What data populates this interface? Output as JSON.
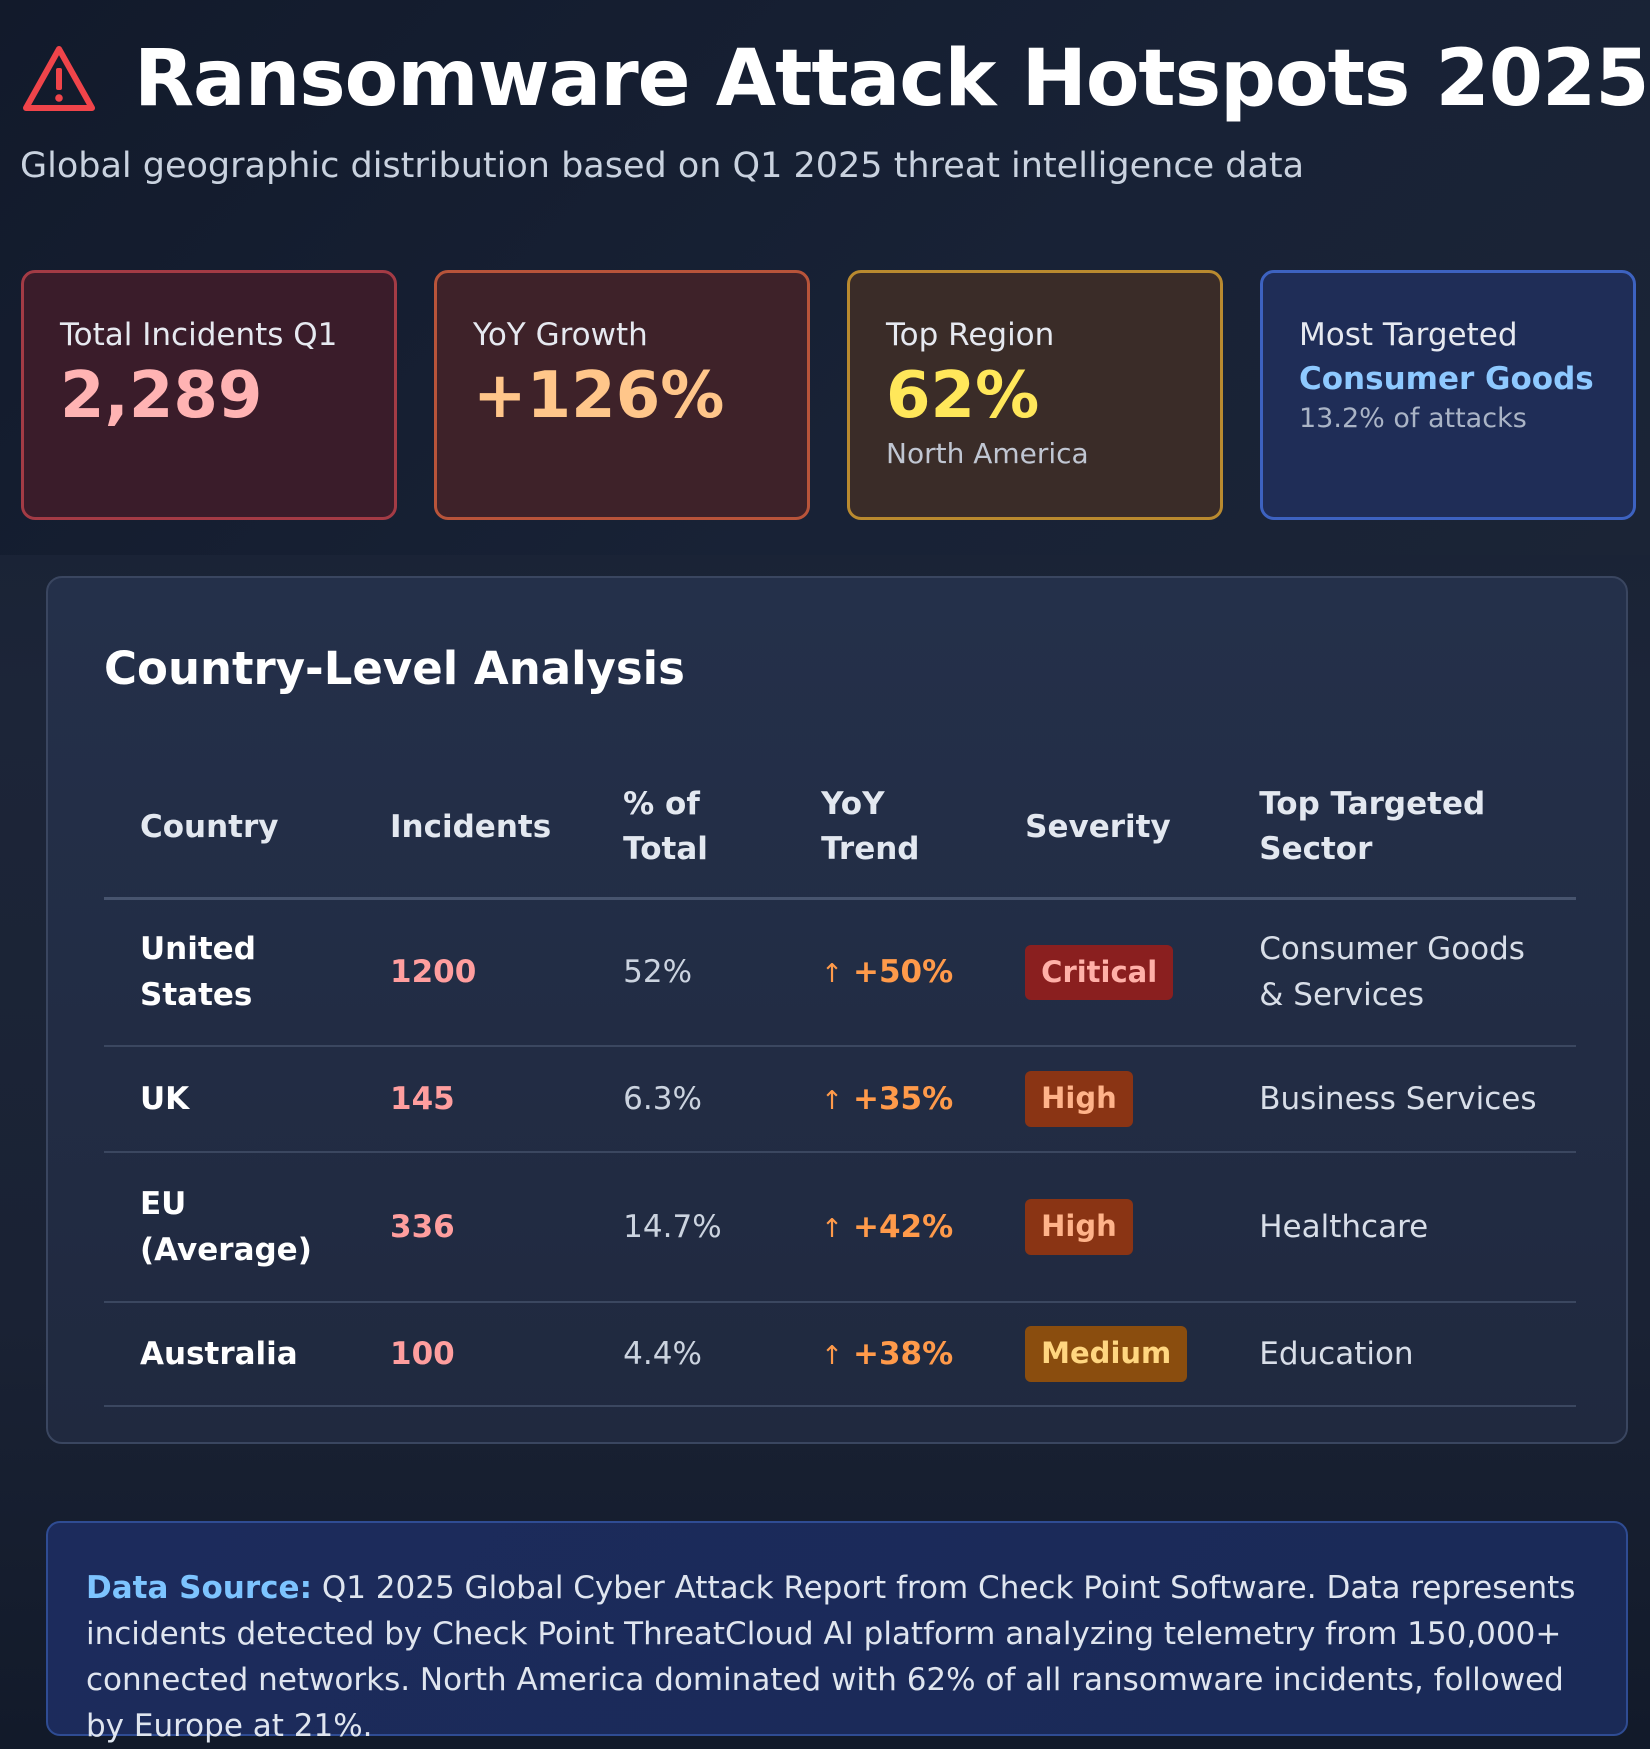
{
  "header": {
    "icon": "warning-triangle-icon",
    "title": "Ransomware Attack Hotspots 2025",
    "subtitle": "Global geographic distribution based on Q1 2025 threat intelligence data"
  },
  "cards": [
    {
      "label": "Total Incidents Q1",
      "value": "2,289",
      "accent": "#ffb3b3"
    },
    {
      "label": "YoY Growth",
      "value": "+126%",
      "accent": "#ffc68a"
    },
    {
      "label": "Top Region",
      "value": "62%",
      "sub": "North America",
      "accent": "#ffe75a"
    },
    {
      "label": "Most Targeted",
      "highlight": "Consumer Goods",
      "sub": "13.2% of attacks",
      "accent": "#8ec9ff"
    }
  ],
  "analysis": {
    "title": "Country-Level Analysis",
    "columns": [
      "Country",
      "Incidents",
      "% of Total",
      "YoY Trend",
      "Severity",
      "Top Targeted Sector"
    ],
    "rows": [
      {
        "country": "United States",
        "incidents": "1200",
        "pct": "52%",
        "trend_arrow": "↑",
        "trend": "+50%",
        "severity": "Critical",
        "sector": "Consumer Goods & Services"
      },
      {
        "country": "UK",
        "incidents": "145",
        "pct": "6.3%",
        "trend_arrow": "↑",
        "trend": "+35%",
        "severity": "High",
        "sector": "Business Services"
      },
      {
        "country": "EU (Average)",
        "incidents": "336",
        "pct": "14.7%",
        "trend_arrow": "↑",
        "trend": "+42%",
        "severity": "High",
        "sector": "Healthcare"
      },
      {
        "country": "Australia",
        "incidents": "100",
        "pct": "4.4%",
        "trend_arrow": "↑",
        "trend": "+38%",
        "severity": "Medium",
        "sector": "Education"
      }
    ]
  },
  "footer": {
    "label": "Data Source:",
    "text": " Q1 2025 Global Cyber Attack Report from Check Point Software. Data represents incidents detected by Check Point ThreatCloud AI platform analyzing telemetry from 150,000+ connected networks. North America dominated with 62% of all ransomware incidents, followed by Europe at 21%."
  },
  "colors": {
    "critical": "#8a1f1f",
    "high": "#8a3414",
    "medium": "#8a4d0e",
    "trend": "#ff9a4a"
  }
}
